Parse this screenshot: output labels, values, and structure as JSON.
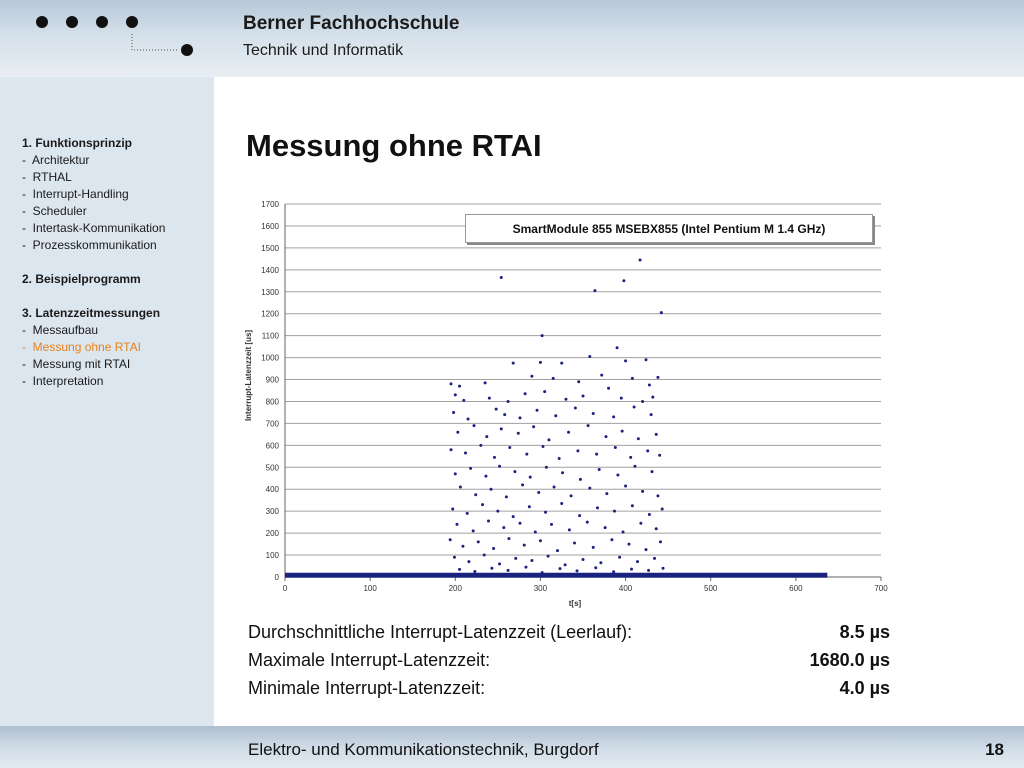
{
  "header": {
    "institution": "Berner Fachhochschule",
    "department": "Technik und Informatik"
  },
  "nav": {
    "sections": [
      {
        "title": "1. Funktionsprinzip",
        "items": [
          "Architektur",
          "RTHAL",
          "Interrupt-Handling",
          "Scheduler",
          "Intertask-Kommunikation",
          "Prozesskommunikation"
        ]
      },
      {
        "title": "2. Beispielprogramm",
        "items": []
      },
      {
        "title": "3. Latenzzeitmessungen",
        "items": [
          "Messaufbau",
          "Messung ohne RTAI",
          "Messung mit RTAI",
          "Interpretation"
        ]
      }
    ],
    "active_item": "Messung ohne RTAI",
    "active_color": "#e8821a"
  },
  "slide": {
    "title": "Messung ohne RTAI"
  },
  "stats": [
    {
      "label": "Durchschnittliche Interrupt-Latenzzeit (Leerlauf):",
      "value": "8.5 µs"
    },
    {
      "label": "Maximale Interrupt-Latenzzeit:",
      "value": "1680.0 µs"
    },
    {
      "label": "Minimale Interrupt-Latenzzeit:",
      "value": "4.0 µs"
    }
  ],
  "footer": {
    "text": "Elektro- und Kommunikationstechnik, Burgdorf",
    "page": "18"
  },
  "colors": {
    "points": "#1a237e",
    "grid": "#a0a0a0"
  },
  "chart_data": {
    "type": "scatter",
    "title": "",
    "legend": "SmartModule 855 MSEBX855 (Intel Pentium M 1.4 GHz)",
    "legend_placement": "top-right",
    "xlabel": "t[s]",
    "ylabel": "Interrupt-Latenzzeit [us]",
    "xlim": [
      0,
      700
    ],
    "ylim": [
      0,
      1700
    ],
    "x_ticks": [
      0,
      100,
      200,
      300,
      400,
      500,
      600,
      700
    ],
    "y_ticks": [
      0,
      100,
      200,
      300,
      400,
      500,
      600,
      700,
      800,
      900,
      1000,
      1100,
      1200,
      1300,
      1400,
      1500,
      1600,
      1700
    ],
    "grid": "horizontal",
    "baseline": {
      "x_start": 0,
      "x_end": 637,
      "y": 8
    },
    "points": [
      [
        254,
        1365
      ],
      [
        364,
        1305
      ],
      [
        398,
        1350
      ],
      [
        417,
        1445
      ],
      [
        442,
        1205
      ],
      [
        302,
        1100
      ],
      [
        390,
        1045
      ],
      [
        358,
        1005
      ],
      [
        400,
        985
      ],
      [
        424,
        990
      ],
      [
        268,
        975
      ],
      [
        300,
        978
      ],
      [
        325,
        975
      ],
      [
        438,
        910
      ],
      [
        195,
        880
      ],
      [
        205,
        870
      ],
      [
        235,
        885
      ],
      [
        290,
        915
      ],
      [
        315,
        905
      ],
      [
        345,
        890
      ],
      [
        372,
        920
      ],
      [
        408,
        905
      ],
      [
        428,
        875
      ],
      [
        200,
        830
      ],
      [
        210,
        805
      ],
      [
        240,
        815
      ],
      [
        262,
        800
      ],
      [
        282,
        835
      ],
      [
        305,
        845
      ],
      [
        330,
        810
      ],
      [
        350,
        825
      ],
      [
        380,
        860
      ],
      [
        395,
        815
      ],
      [
        420,
        800
      ],
      [
        432,
        820
      ],
      [
        198,
        750
      ],
      [
        215,
        720
      ],
      [
        248,
        765
      ],
      [
        258,
        740
      ],
      [
        276,
        725
      ],
      [
        296,
        760
      ],
      [
        318,
        735
      ],
      [
        341,
        770
      ],
      [
        362,
        745
      ],
      [
        386,
        730
      ],
      [
        410,
        775
      ],
      [
        430,
        740
      ],
      [
        203,
        660
      ],
      [
        222,
        690
      ],
      [
        237,
        640
      ],
      [
        254,
        675
      ],
      [
        274,
        655
      ],
      [
        292,
        685
      ],
      [
        310,
        625
      ],
      [
        333,
        660
      ],
      [
        356,
        690
      ],
      [
        377,
        640
      ],
      [
        396,
        665
      ],
      [
        415,
        630
      ],
      [
        436,
        650
      ],
      [
        195,
        580
      ],
      [
        212,
        565
      ],
      [
        230,
        600
      ],
      [
        246,
        545
      ],
      [
        264,
        590
      ],
      [
        284,
        560
      ],
      [
        303,
        595
      ],
      [
        322,
        540
      ],
      [
        344,
        575
      ],
      [
        366,
        560
      ],
      [
        388,
        590
      ],
      [
        406,
        545
      ],
      [
        426,
        575
      ],
      [
        440,
        555
      ],
      [
        200,
        470
      ],
      [
        218,
        495
      ],
      [
        236,
        460
      ],
      [
        252,
        505
      ],
      [
        270,
        480
      ],
      [
        288,
        455
      ],
      [
        307,
        500
      ],
      [
        326,
        475
      ],
      [
        347,
        445
      ],
      [
        369,
        490
      ],
      [
        391,
        465
      ],
      [
        411,
        505
      ],
      [
        431,
        480
      ],
      [
        206,
        410
      ],
      [
        224,
        375
      ],
      [
        242,
        400
      ],
      [
        260,
        365
      ],
      [
        279,
        420
      ],
      [
        298,
        385
      ],
      [
        316,
        410
      ],
      [
        336,
        370
      ],
      [
        358,
        405
      ],
      [
        378,
        380
      ],
      [
        400,
        415
      ],
      [
        420,
        390
      ],
      [
        438,
        370
      ],
      [
        197,
        310
      ],
      [
        214,
        290
      ],
      [
        232,
        330
      ],
      [
        250,
        300
      ],
      [
        268,
        275
      ],
      [
        287,
        320
      ],
      [
        306,
        295
      ],
      [
        325,
        335
      ],
      [
        346,
        280
      ],
      [
        367,
        315
      ],
      [
        387,
        300
      ],
      [
        408,
        325
      ],
      [
        428,
        285
      ],
      [
        443,
        310
      ],
      [
        202,
        240
      ],
      [
        221,
        210
      ],
      [
        239,
        255
      ],
      [
        257,
        225
      ],
      [
        276,
        245
      ],
      [
        294,
        205
      ],
      [
        313,
        240
      ],
      [
        334,
        215
      ],
      [
        355,
        250
      ],
      [
        376,
        225
      ],
      [
        397,
        205
      ],
      [
        418,
        245
      ],
      [
        436,
        220
      ],
      [
        194,
        170
      ],
      [
        209,
        140
      ],
      [
        227,
        160
      ],
      [
        245,
        130
      ],
      [
        263,
        175
      ],
      [
        281,
        145
      ],
      [
        300,
        165
      ],
      [
        320,
        120
      ],
      [
        340,
        155
      ],
      [
        362,
        135
      ],
      [
        384,
        170
      ],
      [
        404,
        150
      ],
      [
        424,
        125
      ],
      [
        441,
        160
      ],
      [
        199,
        90
      ],
      [
        216,
        70
      ],
      [
        234,
        100
      ],
      [
        252,
        60
      ],
      [
        271,
        85
      ],
      [
        290,
        75
      ],
      [
        309,
        95
      ],
      [
        329,
        55
      ],
      [
        350,
        80
      ],
      [
        371,
        65
      ],
      [
        393,
        90
      ],
      [
        414,
        70
      ],
      [
        434,
        85
      ],
      [
        205,
        35
      ],
      [
        223,
        25
      ],
      [
        243,
        40
      ],
      [
        262,
        30
      ],
      [
        283,
        45
      ],
      [
        302,
        20
      ],
      [
        323,
        38
      ],
      [
        343,
        28
      ],
      [
        365,
        42
      ],
      [
        386,
        24
      ],
      [
        407,
        36
      ],
      [
        427,
        30
      ],
      [
        444,
        40
      ]
    ]
  }
}
